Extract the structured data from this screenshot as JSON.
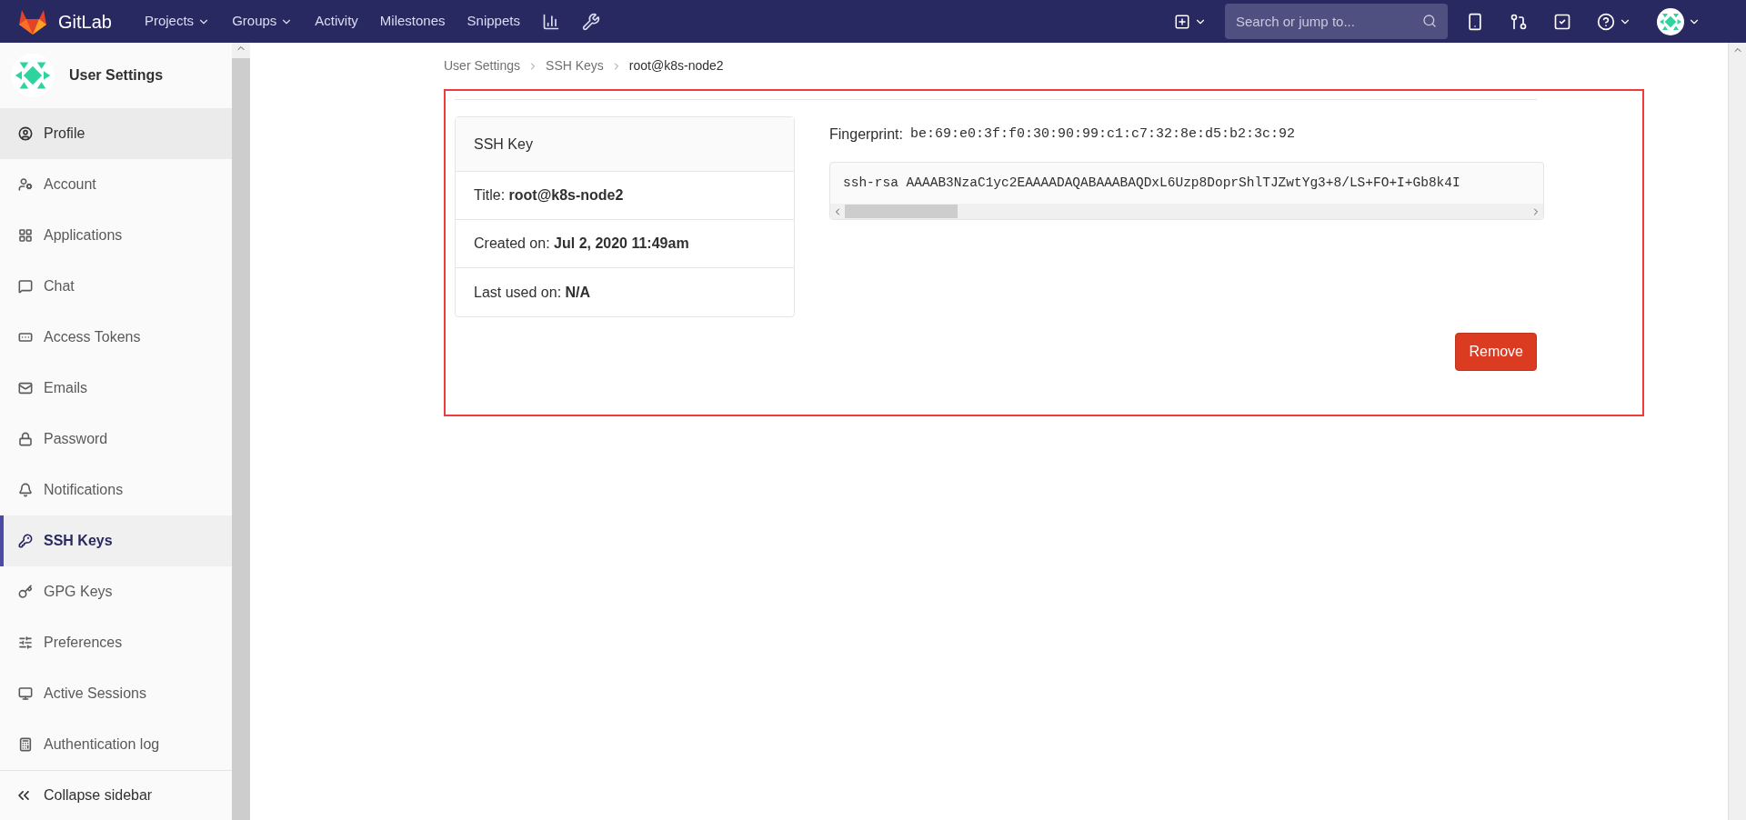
{
  "navbar": {
    "brand": "GitLab",
    "items": [
      {
        "label": "Projects",
        "dropdown": true
      },
      {
        "label": "Groups",
        "dropdown": true
      },
      {
        "label": "Activity",
        "dropdown": false
      },
      {
        "label": "Milestones",
        "dropdown": false
      },
      {
        "label": "Snippets",
        "dropdown": false
      }
    ],
    "search": {
      "placeholder": "Search or jump to..."
    }
  },
  "sidebar": {
    "title": "User Settings",
    "items": [
      {
        "label": "Profile",
        "selected": false,
        "hovered": true
      },
      {
        "label": "Account",
        "selected": false,
        "hovered": false
      },
      {
        "label": "Applications",
        "selected": false,
        "hovered": false
      },
      {
        "label": "Chat",
        "selected": false,
        "hovered": false
      },
      {
        "label": "Access Tokens",
        "selected": false,
        "hovered": false
      },
      {
        "label": "Emails",
        "selected": false,
        "hovered": false
      },
      {
        "label": "Password",
        "selected": false,
        "hovered": false
      },
      {
        "label": "Notifications",
        "selected": false,
        "hovered": false
      },
      {
        "label": "SSH Keys",
        "selected": true,
        "hovered": false
      },
      {
        "label": "GPG Keys",
        "selected": false,
        "hovered": false
      },
      {
        "label": "Preferences",
        "selected": false,
        "hovered": false
      },
      {
        "label": "Active Sessions",
        "selected": false,
        "hovered": false
      },
      {
        "label": "Authentication log",
        "selected": false,
        "hovered": false
      }
    ],
    "collapse": "Collapse sidebar"
  },
  "breadcrumb": [
    "User Settings",
    "SSH Keys",
    "root@k8s-node2"
  ],
  "key_card": {
    "header": "SSH Key",
    "rows": [
      {
        "label": "Title:",
        "value": "root@k8s-node2"
      },
      {
        "label": "Created on:",
        "value": "Jul 2, 2020 11:49am"
      },
      {
        "label": "Last used on:",
        "value": "N/A"
      }
    ]
  },
  "fingerprint": {
    "label": "Fingerprint:",
    "value": "be:69:e0:3f:f0:30:90:99:c1:c7:32:8e:d5:b2:3c:92"
  },
  "public_key": "ssh-rsa AAAAB3NzaC1yc2EAAAADAQABAAABAQDxL6Uzp8DoprShlTJZwtYg3+8/LS+FO+I+Gb8k4I",
  "remove_button": "Remove"
}
